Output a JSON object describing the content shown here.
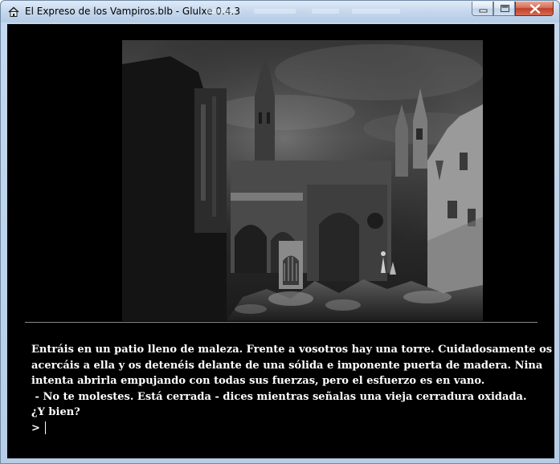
{
  "window": {
    "title": "El Expreso de los Vampiros.blb - Glulxe 0.4.3",
    "app_icon": "home-icon",
    "controls": [
      "minimize-icon",
      "maximize-icon",
      "close-icon"
    ]
  },
  "game": {
    "illustration": "ruined-castle-courtyard",
    "text_lines": [
      "Entráis en un patio lleno de maleza. Frente a vosotros hay una torre. Cuidadosamente os",
      "acercáis a ella y os detenéis delante de una sólida e imponente puerta de madera. Nina",
      "intenta abrirla empujando con todas sus fuerzas, pero el esfuerzo es en vano.",
      " - No te molestes. Está cerrada - dices mientras señalas una vieja cerradura oxidada.",
      "¿Y bien?"
    ],
    "prompt": ">",
    "input_value": ""
  },
  "colors": {
    "background": "#000000",
    "text": "#ffffff",
    "divider": "#8a8a8a",
    "titlebar": "#c3d6ec",
    "close_button": "#c0402a"
  }
}
